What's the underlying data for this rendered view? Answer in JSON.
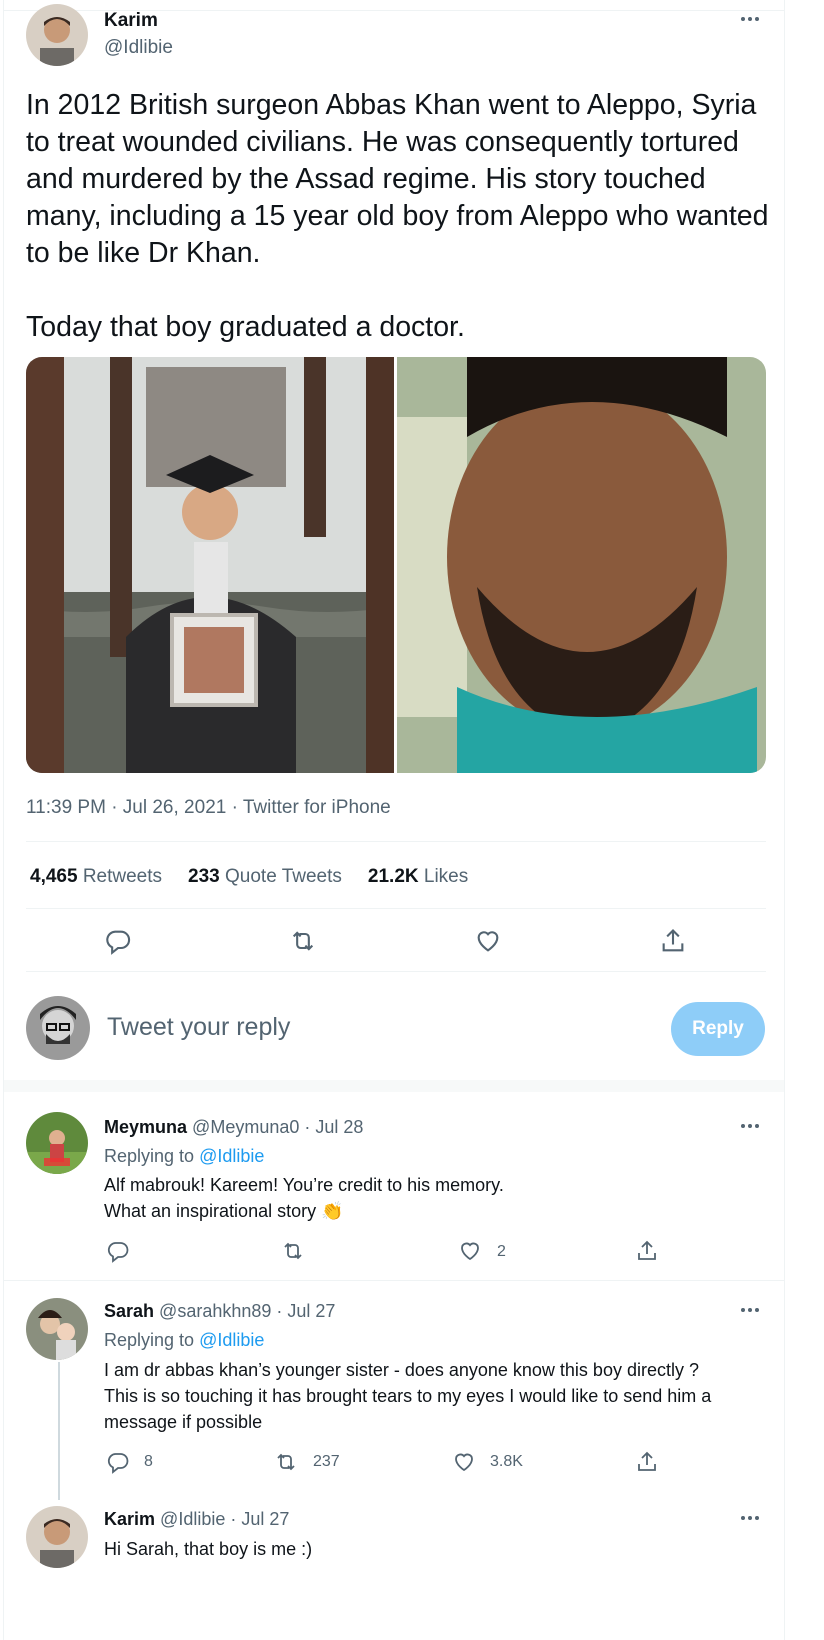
{
  "tweet": {
    "author_name": "Karim",
    "author_handle": "@Idlibie",
    "text": "In 2012 British surgeon Abbas Khan went to Aleppo, Syria to treat wounded civilians. He was consequently tortured and murdered by the Assad regime. His story touched many, including a 15 year old boy from Aleppo who wanted to be like Dr Khan.\n\nToday that boy graduated a doctor.",
    "meta": "11:39 PM · Jul 26, 2021 · Twitter for iPhone",
    "retweets_count": "4,465",
    "retweets_label": "Retweets",
    "quotes_count": "233",
    "quotes_label": "Quote Tweets",
    "likes_count": "21.2K",
    "likes_label": "Likes"
  },
  "composer": {
    "placeholder": "Tweet your reply",
    "button": "Reply"
  },
  "replies": [
    {
      "name": "Meymuna",
      "handle_date": "@Meymuna0 · Jul 28",
      "replying_prefix": "Replying to ",
      "replying_to": "@Idlibie",
      "text": "Alf mabrouk! Kareem! You’re credit to his memory.\nWhat an inspirational story 👏",
      "likes": "2"
    },
    {
      "name": "Sarah",
      "handle_date": "@sarahkhn89 · Jul 27",
      "replying_prefix": "Replying to ",
      "replying_to": "@Idlibie",
      "text": "I am dr abbas khan’s younger sister - does anyone know this boy directly ?\nThis is so touching it has brought tears to my eyes I would like to send him a\nmessage if possible",
      "replies": "8",
      "retweets": "237",
      "likes": "3.8K"
    },
    {
      "name": "Karim",
      "handle_date": "@Idlibie · Jul 27",
      "text": "Hi Sarah, that boy is me :)"
    }
  ],
  "icons": {
    "reply": "reply-icon",
    "retweet": "retweet-icon",
    "like": "heart-icon",
    "share": "share-icon",
    "more": "more-icon"
  },
  "colors": {
    "accent": "#1d9bf0",
    "reply_button": "#8ecdf8",
    "secondary_text": "#536471"
  }
}
